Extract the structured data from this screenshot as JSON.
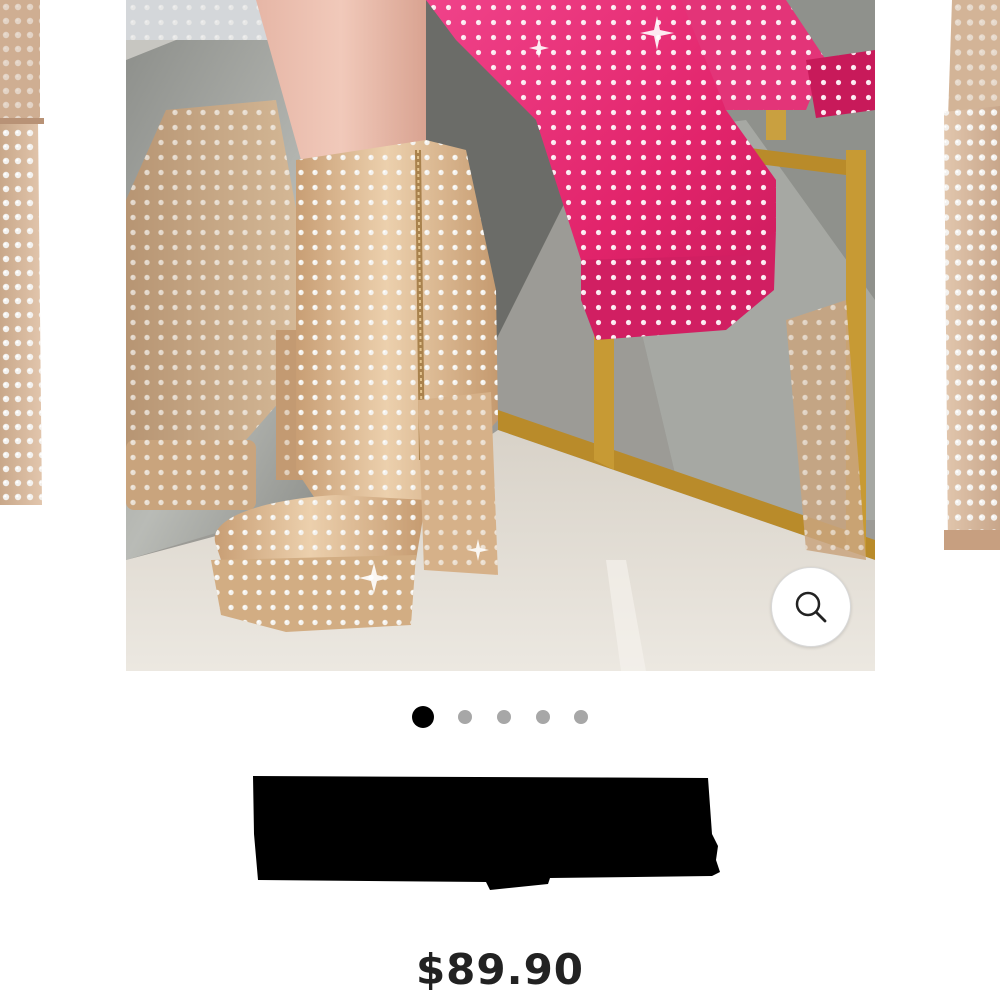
{
  "gallery": {
    "active_slide": 1,
    "slide_count": 5,
    "zoom_icon": "magnifier-icon",
    "main_image": "studded-platform-ankle-boots-photo"
  },
  "product": {
    "title": "",
    "title_redacted": true,
    "price": "$89.90"
  },
  "colors": {
    "dot_active": "#000000",
    "dot_inactive": "#a7a7a7",
    "price_text": "#222222",
    "boot_nude": "#d9b48a",
    "boot_pink": "#e8327a"
  }
}
